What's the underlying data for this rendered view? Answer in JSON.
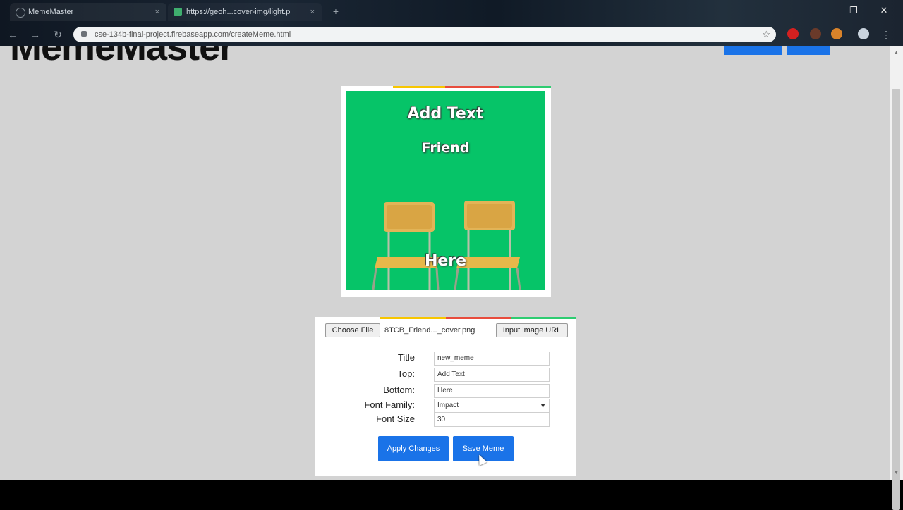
{
  "browser": {
    "tabs": [
      {
        "title": "MemeMaster",
        "close": "×"
      },
      {
        "title": "https://geoh...cover-img/light.p",
        "close": "×"
      }
    ],
    "new_tab": "+",
    "window_controls": {
      "minimize": "–",
      "restore": "❐",
      "close": "✕"
    },
    "nav": {
      "back": "←",
      "forward": "→",
      "reload": "↻"
    },
    "url": "cse-134b-final-project.firebaseapp.com/createMeme.html",
    "star": "☆"
  },
  "page": {
    "brand": "MemeMaster",
    "meme": {
      "top_text": "Add Text",
      "middle_text": "Friend",
      "bottom_text": "Here",
      "background_color": "#06c468"
    },
    "form": {
      "choose_file_label": "Choose File",
      "file_name": "8TCB_Friend..._cover.png",
      "input_url_label": "Input image URL",
      "labels": {
        "title": "Title",
        "top": "Top:",
        "bottom": "Bottom:",
        "font_family": "Font Family:",
        "font_size": "Font Size"
      },
      "values": {
        "title": "new_meme",
        "top": "Add Text",
        "bottom": "Here",
        "font_family": "Impact",
        "font_size": "30"
      },
      "apply_label": "Apply Changes",
      "save_label": "Save Meme"
    }
  },
  "colors": {
    "accent_blue": "#1a73e8",
    "stripe": [
      "#f7c600",
      "#e84c3d",
      "#2ecc71"
    ]
  }
}
